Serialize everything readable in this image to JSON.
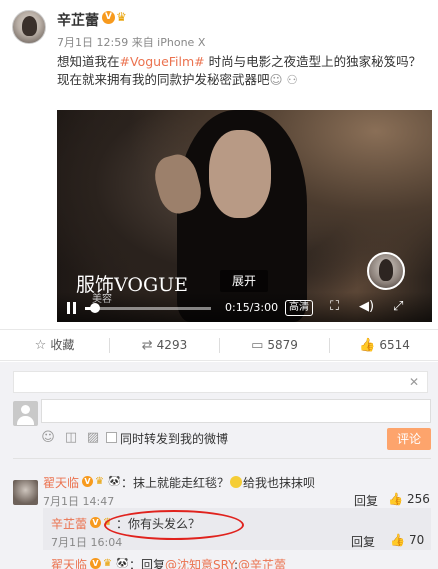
{
  "post": {
    "author": "辛芷蕾",
    "verified_badge": "V",
    "meta": "7月1日 12:59 来自 iPhone X",
    "text_prefix": "想知道我在",
    "hashtag": "#VogueFilm#",
    "text_mid": " 时尚与电影之夜造型上的独家秘笈吗？现在就来拥有我的同款护发秘密武器吧",
    "text_suffix": "  ",
    "text_icons": "☺ ⚇"
  },
  "video": {
    "brand": "服饰VOGUE",
    "brand_sub": "美容",
    "expand_label": "展开",
    "time": "0:15/3:00",
    "progress": 0.083,
    "hd_label": "高清"
  },
  "actions": {
    "favorite_label": "收藏",
    "repost_count": "4293",
    "comment_count": "5879",
    "like_count": "6514"
  },
  "composer": {
    "input_value": "",
    "checkbox_label": "同时转发到我的微博",
    "submit_label": "评论"
  },
  "comments": [
    {
      "author": "翟天临",
      "text_a": "：抹上就能走红毯？",
      "text_b": "给我也抹抹呗",
      "time": "7月1日 14:47",
      "reply_label": "回复",
      "likes": "256"
    }
  ],
  "reply": {
    "author": "辛芷蕾",
    "text": "：你有头发么？",
    "time": "7月1日 16:04",
    "reply_label": "回复",
    "likes": "70"
  },
  "next_comment": {
    "author": "翟天临",
    "text_prefix": "：回复",
    "mention1": "@沈知意SRY",
    "colon": ":",
    "mention2": "@辛芷蕾"
  }
}
